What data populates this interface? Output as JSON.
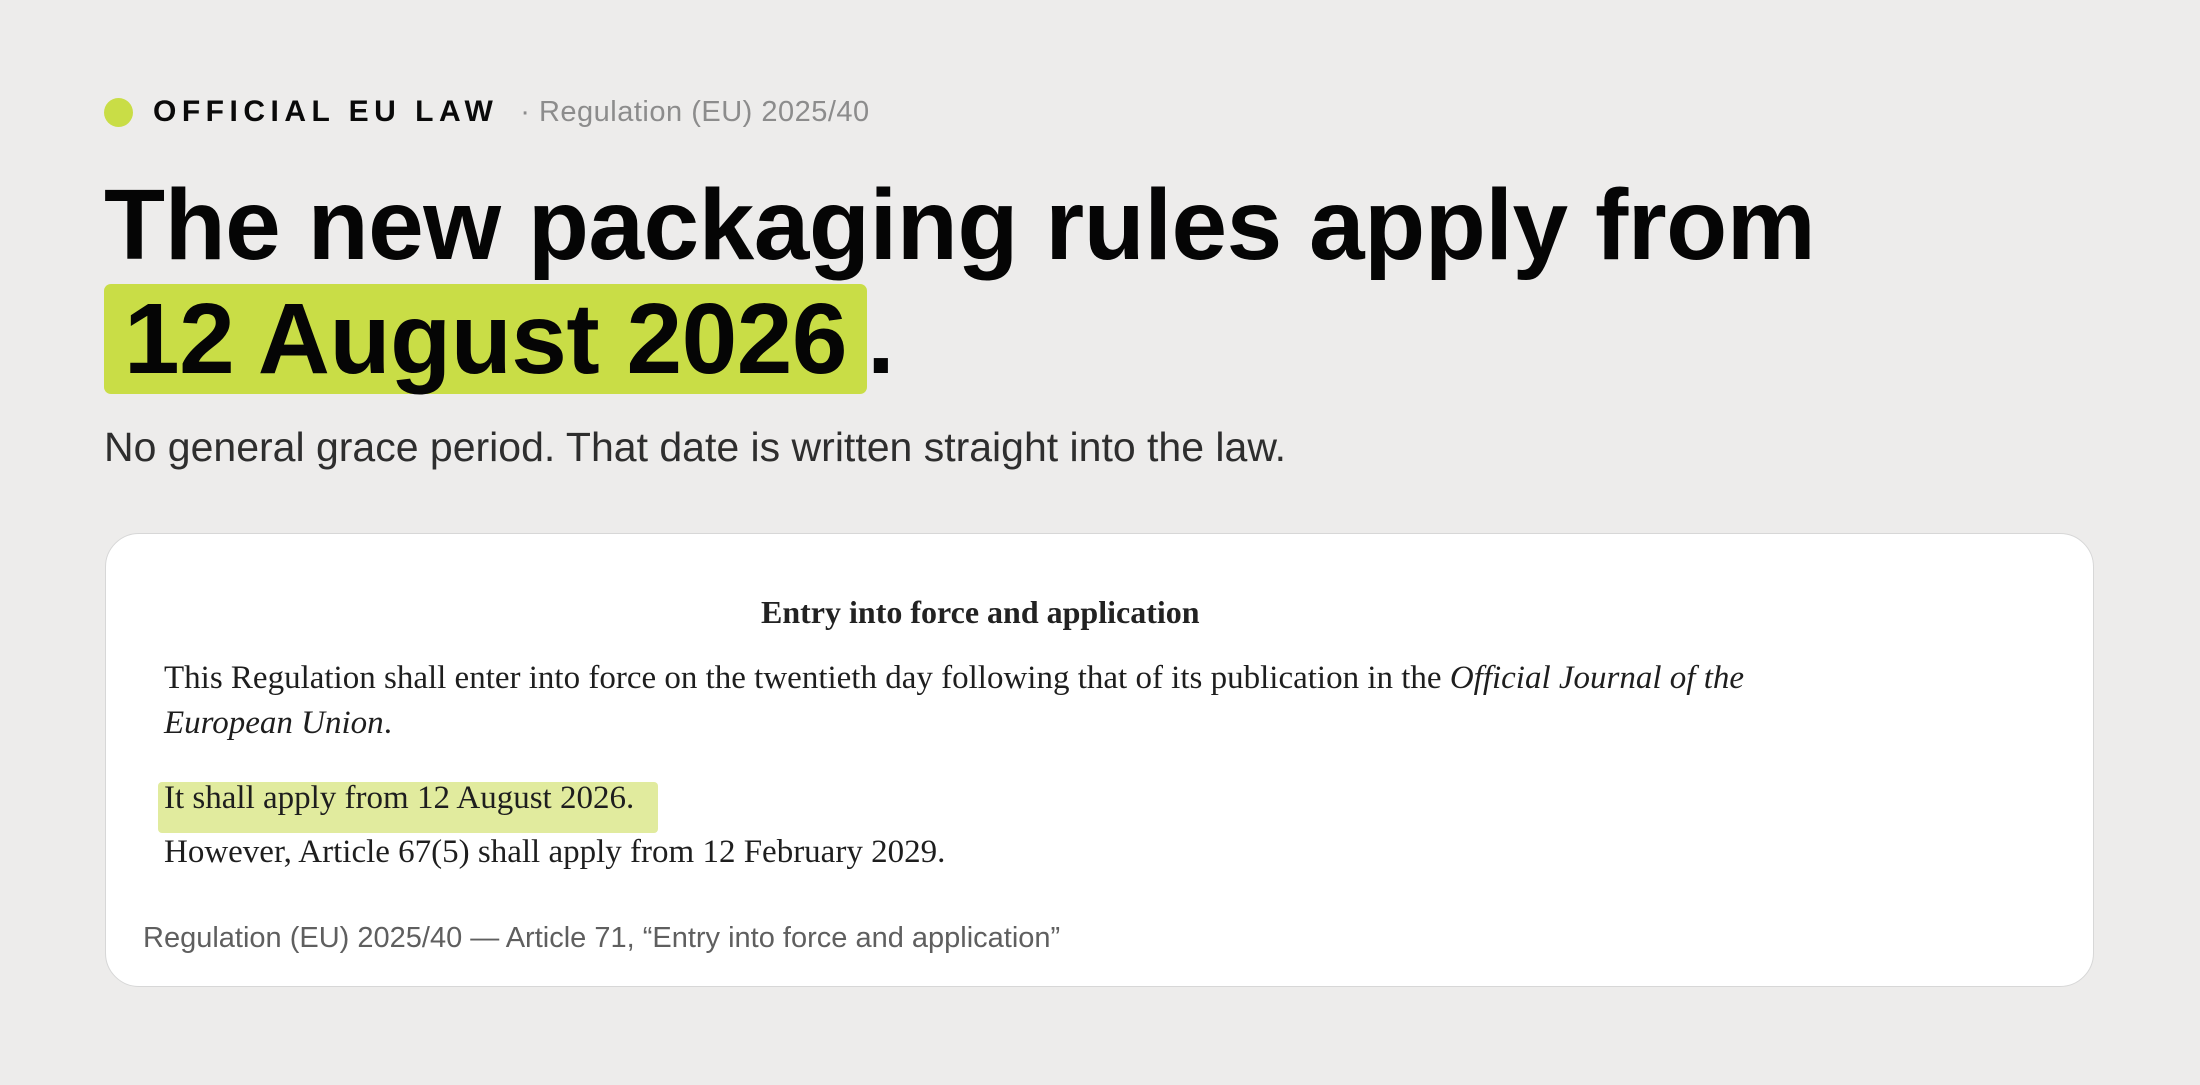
{
  "eyebrow": {
    "label": "OFFICIAL EU LAW",
    "reference": "· Regulation (EU) 2025/40",
    "accent_color": "#c9dd46"
  },
  "headline": {
    "line1": "The new packaging rules apply from",
    "highlight": "12 August 2026",
    "suffix": "."
  },
  "subheadline": "No general grace period. That date is written straight into the law.",
  "excerpt": {
    "title": "Entry into force and application",
    "paragraph1_text": "This Regulation shall enter into force on the twentieth day following that of its publication in the ",
    "paragraph1_italic": "Official Journal of the European Union",
    "paragraph1_end": ".",
    "paragraph2": "It shall apply from 12 August 2026.",
    "paragraph3": "However, Article 67(5) shall apply from 12 February 2029.",
    "highlight_color": "#e1eb9e"
  },
  "caption": "Regulation (EU) 2025/40 — Article 71, “Entry into force and application”"
}
